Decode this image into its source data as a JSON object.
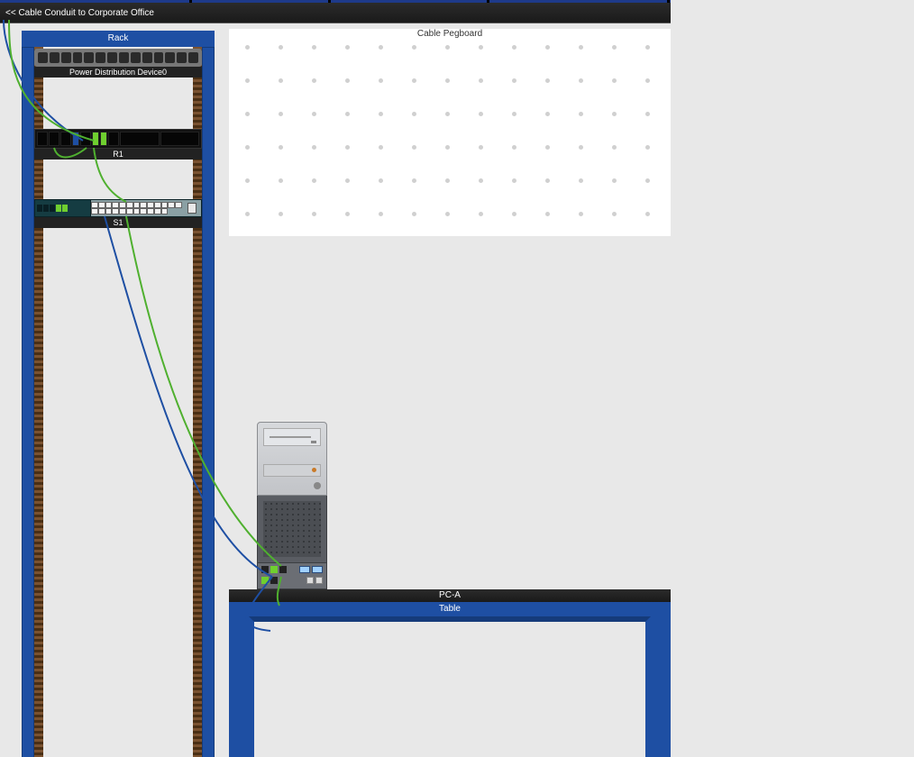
{
  "topbar": {
    "link_label": "<< Cable Conduit to Corporate Office"
  },
  "rack": {
    "title": "Rack",
    "pdu_label": "Power Distribution Device0",
    "r1_label": "R1",
    "s1_label": "S1"
  },
  "pegboard": {
    "title": "Cable Pegboard"
  },
  "pc": {
    "label": "PC-A"
  },
  "table": {
    "label": "Table"
  },
  "icons": {
    "outlet": "power-outlet",
    "port": "ethernet-port"
  }
}
